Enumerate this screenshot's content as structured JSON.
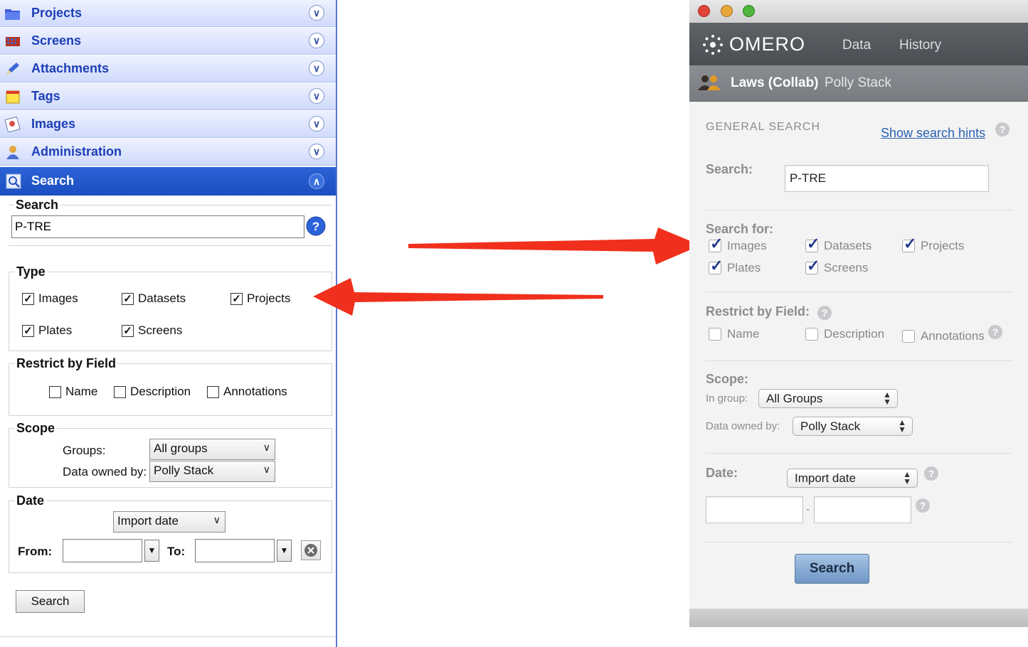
{
  "left_panel": {
    "accordion": [
      {
        "label": "Projects",
        "icon": "folder-icon"
      },
      {
        "label": "Screens",
        "icon": "screen-plate-icon"
      },
      {
        "label": "Attachments",
        "icon": "pencil-icon"
      },
      {
        "label": "Tags",
        "icon": "tag-note-icon"
      },
      {
        "label": "Images",
        "icon": "image-icon"
      },
      {
        "label": "Administration",
        "icon": "admin-user-icon"
      }
    ],
    "active_section": {
      "label": "Search",
      "icon": "magnifier-icon"
    },
    "search_group": {
      "legend": "Search",
      "value": "P-TRE"
    },
    "type_group": {
      "legend": "Type",
      "options": [
        {
          "label": "Images",
          "checked": true
        },
        {
          "label": "Datasets",
          "checked": true
        },
        {
          "label": "Projects",
          "checked": true
        },
        {
          "label": "Plates",
          "checked": true
        },
        {
          "label": "Screens",
          "checked": true
        }
      ]
    },
    "restrict_group": {
      "legend": "Restrict by Field",
      "options": [
        {
          "label": "Name",
          "checked": false
        },
        {
          "label": "Description",
          "checked": false
        },
        {
          "label": "Annotations",
          "checked": false
        }
      ]
    },
    "scope_group": {
      "legend": "Scope",
      "groups_label": "Groups:",
      "groups_value": "All groups",
      "owner_label": "Data owned by:",
      "owner_value": "Polly Stack"
    },
    "date_group": {
      "legend": "Date",
      "date_type": "Import date",
      "from_label": "From:",
      "to_label": "To:"
    },
    "search_button": "Search"
  },
  "right_panel": {
    "app_name": "OMERO",
    "nav": [
      "Data",
      "History"
    ],
    "user_bar": {
      "group": "Laws (Collab)",
      "user": "Polly Stack"
    },
    "general_search_heading": "GENERAL SEARCH",
    "show_hints_link": "Show search hints",
    "search_label": "Search:",
    "search_value": "P-TRE",
    "search_for_label": "Search for:",
    "search_for_options": [
      {
        "label": "Images",
        "checked": true
      },
      {
        "label": "Datasets",
        "checked": true
      },
      {
        "label": "Projects",
        "checked": true
      },
      {
        "label": "Plates",
        "checked": true
      },
      {
        "label": "Screens",
        "checked": true
      }
    ],
    "restrict_label": "Restrict by Field:",
    "restrict_options": [
      {
        "label": "Name",
        "checked": false
      },
      {
        "label": "Description",
        "checked": false
      },
      {
        "label": "Annotations",
        "checked": false
      }
    ],
    "scope_label": "Scope:",
    "in_group_label": "In group:",
    "in_group_value": "All Groups",
    "owned_by_label": "Data owned by:",
    "owned_by_value": "Polly Stack",
    "date_label": "Date:",
    "date_type": "Import date",
    "date_separator": "-",
    "search_button": "Search",
    "help_glyph": "?"
  },
  "colors": {
    "arrow": "#f0301c",
    "left_active_header": "#1b4dbf",
    "right_nav_bar": "#54585d"
  }
}
